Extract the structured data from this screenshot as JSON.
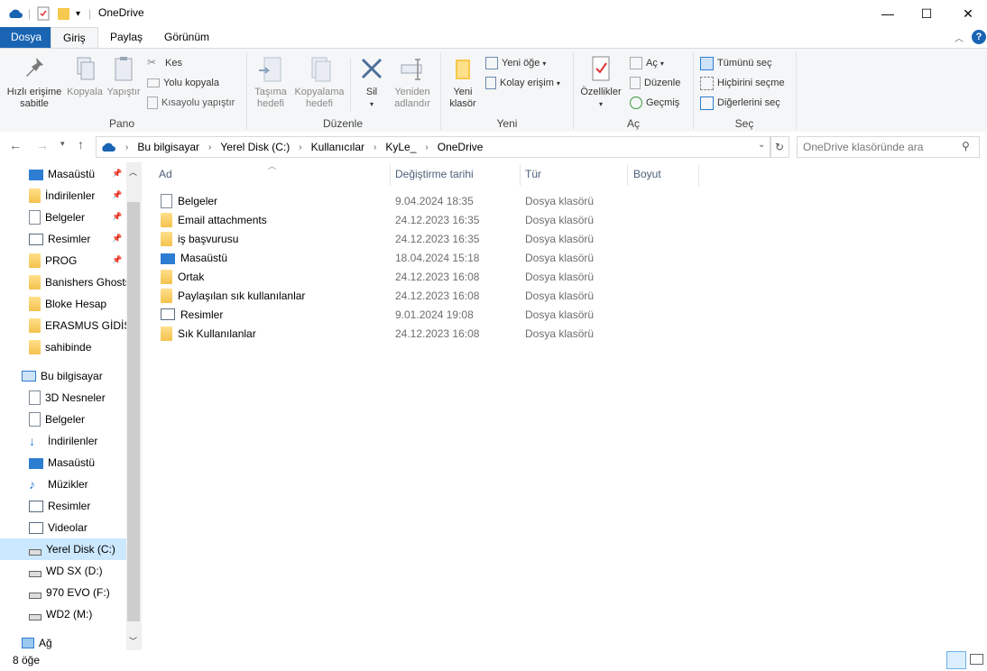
{
  "window": {
    "title": "OneDrive",
    "minimize": "—",
    "maximize": "☐",
    "close": "✕"
  },
  "ribbon_tabs": [
    "Dosya",
    "Giriş",
    "Paylaş",
    "Görünüm"
  ],
  "ribbon": {
    "pano": {
      "label": "Pano",
      "pin": "Hızlı erişime sabitle",
      "copy": "Kopyala",
      "paste": "Yapıştır",
      "cut": "Kes",
      "copy_path": "Yolu kopyala",
      "paste_shortcut": "Kısayolu yapıştır"
    },
    "duzenle": {
      "label": "Düzenle",
      "move_to": "Taşıma hedefi",
      "copy_to": "Kopyalama hedefi",
      "delete": "Sil",
      "rename": "Yeniden adlandır"
    },
    "yeni": {
      "label": "Yeni",
      "new_folder": "Yeni klasör",
      "new_item": "Yeni öğe",
      "easy_access": "Kolay erişim"
    },
    "ac": {
      "label": "Aç",
      "properties": "Özellikler",
      "open": "Aç",
      "edit": "Düzenle",
      "history": "Geçmiş"
    },
    "sec": {
      "label": "Seç",
      "select_all": "Tümünü seç",
      "select_none": "Hiçbirini seçme",
      "invert": "Diğerlerini seç"
    }
  },
  "address": {
    "crumbs": [
      "Bu bilgisayar",
      "Yerel Disk (C:)",
      "Kullanıcılar",
      "KyLe_",
      "OneDrive"
    ],
    "search_placeholder": "OneDrive klasöründe ara"
  },
  "nav": {
    "quick": [
      {
        "label": "Masaüstü",
        "pinned": true
      },
      {
        "label": "İndirilenler",
        "pinned": true
      },
      {
        "label": "Belgeler",
        "pinned": true
      },
      {
        "label": "Resimler",
        "pinned": true
      },
      {
        "label": "PROG",
        "pinned": true
      },
      {
        "label": "Banishers Ghosts",
        "pinned": false
      },
      {
        "label": "Bloke Hesap",
        "pinned": false
      },
      {
        "label": "ERASMUS GİDİŞ",
        "pinned": false
      },
      {
        "label": "sahibinde",
        "pinned": false
      }
    ],
    "this_pc": "Bu bilgisayar",
    "pc_items": [
      "3D Nesneler",
      "Belgeler",
      "İndirilenler",
      "Masaüstü",
      "Müzikler",
      "Resimler",
      "Videolar",
      "Yerel Disk (C:)",
      "WD SX (D:)",
      "970 EVO (F:)",
      "WD2 (M:)"
    ],
    "network": "Ağ"
  },
  "columns": [
    "Ad",
    "Değiştirme tarihi",
    "Tür",
    "Boyut"
  ],
  "files": [
    {
      "name": "Belgeler",
      "date": "9.04.2024 18:35",
      "type": "Dosya klasörü",
      "icon": "doc"
    },
    {
      "name": "Email attachments",
      "date": "24.12.2023 16:35",
      "type": "Dosya klasörü",
      "icon": "folder"
    },
    {
      "name": "iş başvurusu",
      "date": "24.12.2023 16:35",
      "type": "Dosya klasörü",
      "icon": "folder"
    },
    {
      "name": "Masaüstü",
      "date": "18.04.2024 15:18",
      "type": "Dosya klasörü",
      "icon": "desk"
    },
    {
      "name": "Ortak",
      "date": "24.12.2023 16:08",
      "type": "Dosya klasörü",
      "icon": "folder"
    },
    {
      "name": "Paylaşılan sık kullanılanlar",
      "date": "24.12.2023 16:08",
      "type": "Dosya klasörü",
      "icon": "folder"
    },
    {
      "name": "Resimler",
      "date": "9.01.2024 19:08",
      "type": "Dosya klasörü",
      "icon": "pics"
    },
    {
      "name": "Sık Kullanılanlar",
      "date": "24.12.2023 16:08",
      "type": "Dosya klasörü",
      "icon": "folder"
    }
  ],
  "status": "8 öğe",
  "colors": {
    "accent": "#1a65b3",
    "selected_nav": "#cce8ff"
  }
}
